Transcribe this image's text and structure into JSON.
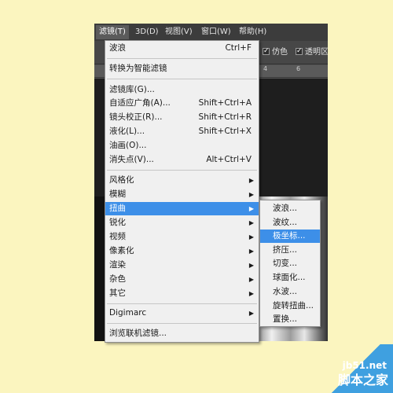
{
  "menubar": {
    "items": [
      {
        "label": "滤镜(T)"
      },
      {
        "label": "3D(D)"
      },
      {
        "label": "视图(V)"
      },
      {
        "label": "窗口(W)"
      },
      {
        "label": "帮助(H)"
      }
    ]
  },
  "options_bar": {
    "fake_label": "仿色",
    "transparent_label": "透明区域"
  },
  "ruler": {
    "ticks": [
      "4",
      "6"
    ]
  },
  "filter_menu": {
    "items": [
      {
        "label": "波浪",
        "shortcut": "Ctrl+F"
      },
      {
        "label": "转换为智能滤镜"
      },
      {
        "label": "滤镜库(G)..."
      },
      {
        "label": "自适应广角(A)...",
        "shortcut": "Shift+Ctrl+A"
      },
      {
        "label": "镜头校正(R)...",
        "shortcut": "Shift+Ctrl+R"
      },
      {
        "label": "液化(L)...",
        "shortcut": "Shift+Ctrl+X"
      },
      {
        "label": "油画(O)..."
      },
      {
        "label": "消失点(V)...",
        "shortcut": "Alt+Ctrl+V"
      },
      {
        "label": "风格化"
      },
      {
        "label": "模糊"
      },
      {
        "label": "扭曲"
      },
      {
        "label": "锐化"
      },
      {
        "label": "视频"
      },
      {
        "label": "像素化"
      },
      {
        "label": "渲染"
      },
      {
        "label": "杂色"
      },
      {
        "label": "其它"
      },
      {
        "label": "Digimarc"
      },
      {
        "label": "浏览联机滤镜..."
      }
    ]
  },
  "distort_submenu": {
    "items": [
      {
        "label": "波浪..."
      },
      {
        "label": "波纹..."
      },
      {
        "label": "极坐标..."
      },
      {
        "label": "挤压..."
      },
      {
        "label": "切变..."
      },
      {
        "label": "球面化..."
      },
      {
        "label": "水波..."
      },
      {
        "label": "旋转扭曲..."
      },
      {
        "label": "置换..."
      }
    ]
  },
  "watermark": {
    "site": "jb51.net",
    "brand": "脚本之家"
  },
  "colors": {
    "page_background": "#fbf5bf",
    "highlight": "#3d8fe8",
    "menu_background": "#f0f0f0"
  }
}
